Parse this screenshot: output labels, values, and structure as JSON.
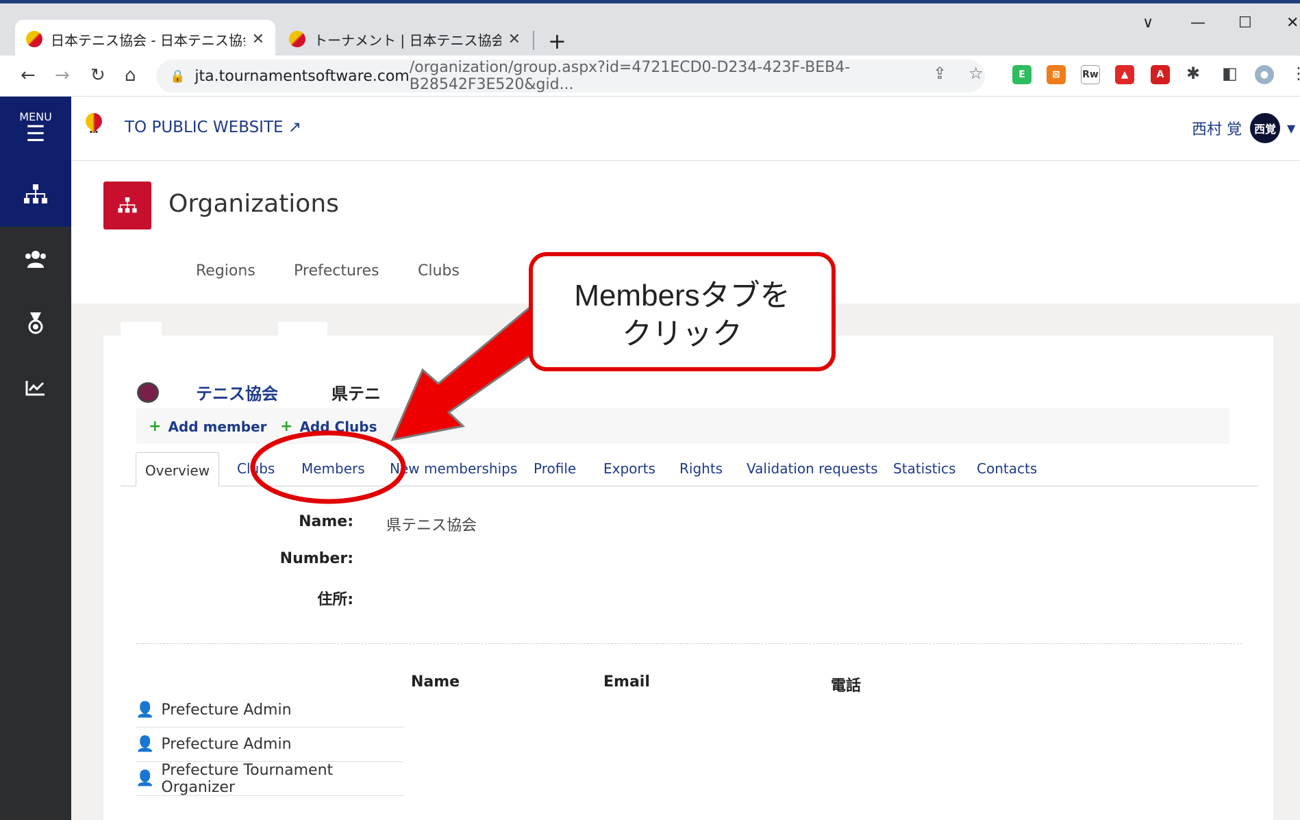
{
  "browser": {
    "tabs": [
      {
        "title": "日本テニス協会 - 日本テニス協会",
        "active": true
      },
      {
        "title": "トーナメント | 日本テニス協会公式サ",
        "active": false
      }
    ],
    "close_glyph": "✕",
    "new_tab_glyph": "+",
    "window_controls": {
      "chevron": "∨",
      "minimize": "—",
      "maximize": "☐",
      "close": "✕"
    },
    "url_host": "jta.tournamentsoftware.com",
    "url_rest": "/organization/group.aspx?id=4721ECD0-D234-423F-BEB4-B28542F3E520&gid...",
    "icons": [
      "back-icon",
      "forward-icon",
      "reload-icon",
      "home-icon",
      "lock-icon",
      "share-icon",
      "star-icon",
      "extensions-icon",
      "sidepanel-icon",
      "profile-icon",
      "kebab-icon"
    ]
  },
  "sidebar": {
    "menu_label": "MENU",
    "items": [
      "organizations-icon",
      "members-icon",
      "medal-icon",
      "stats-icon"
    ]
  },
  "header": {
    "public_link": "TO PUBLIC WEBSITE",
    "user_name": "西村 覚",
    "avatar_text": "西覚"
  },
  "org": {
    "title": "Organizations",
    "subnav": [
      "Regions",
      "Prefectures",
      "Clubs"
    ]
  },
  "club": {
    "name": "テニス協会",
    "name2": "県テニ"
  },
  "actions": {
    "add_member": "Add member",
    "add_clubs": "Add Clubs"
  },
  "tabs": [
    "Overview",
    "Clubs",
    "Members",
    "New memberships",
    "Profile",
    "Exports",
    "Rights",
    "Validation requests",
    "Statistics",
    "Contacts"
  ],
  "fields": {
    "name_label": "Name:",
    "name_value": "県テニス協会",
    "number_label": "Number:",
    "address_label": "住所:"
  },
  "members_table": {
    "headers": [
      "Name",
      "Email",
      "電話"
    ],
    "rows": [
      "Prefecture Admin",
      "Prefecture Admin",
      "Prefecture Tournament Organizer"
    ]
  },
  "annotation": {
    "line1": "Membersタブを",
    "line2": "クリック"
  },
  "colors": {
    "accent_red": "#c8102e",
    "annotation_red": "#e10000",
    "nav_blue": "#0f1f6b",
    "link_blue": "#1d3a8a"
  }
}
